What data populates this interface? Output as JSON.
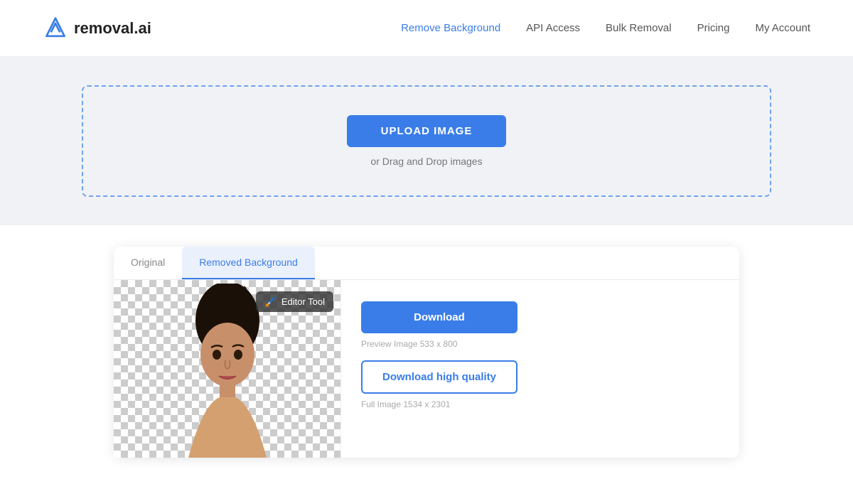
{
  "header": {
    "logo_text": "removal.ai",
    "nav": [
      {
        "label": "Remove Background",
        "active": true,
        "id": "remove-background"
      },
      {
        "label": "API Access",
        "active": false,
        "id": "api-access"
      },
      {
        "label": "Bulk Removal",
        "active": false,
        "id": "bulk-removal"
      },
      {
        "label": "Pricing",
        "active": false,
        "id": "pricing"
      },
      {
        "label": "My Account",
        "active": false,
        "id": "my-account"
      }
    ]
  },
  "upload": {
    "button_label": "UPLOAD IMAGE",
    "hint": "or Drag and Drop images"
  },
  "preview": {
    "tabs": [
      {
        "label": "Original",
        "active": false
      },
      {
        "label": "Removed Background",
        "active": true
      }
    ],
    "editor_tool_label": "Editor Tool",
    "download_button": "Download",
    "preview_hint": "Preview Image  533 x 800",
    "download_hq_button": "Download high quality",
    "full_hint": "Full Image  1534 x 2301"
  }
}
